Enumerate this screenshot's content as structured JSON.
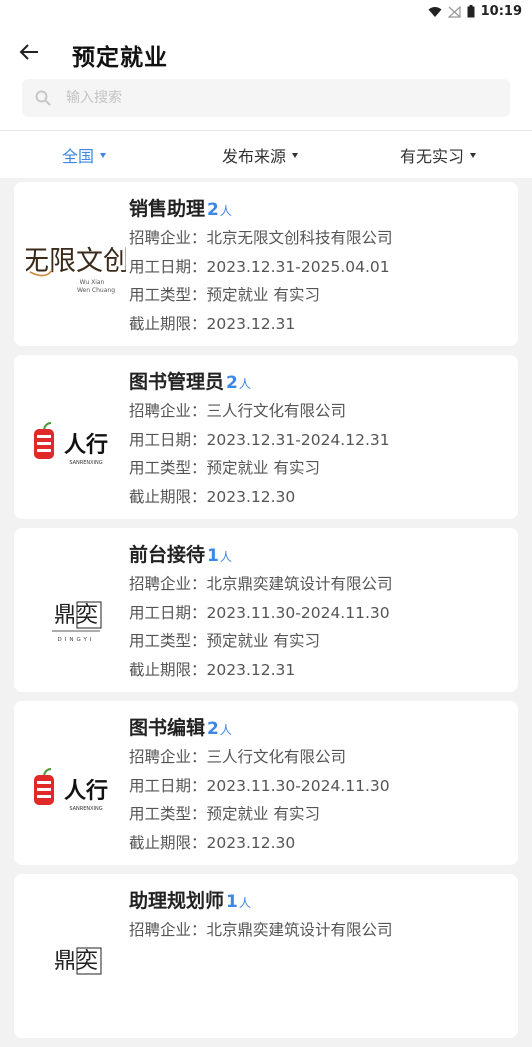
{
  "status_bar": {
    "time": "10:19"
  },
  "header": {
    "title": "预定就业"
  },
  "search": {
    "placeholder": "输入搜索"
  },
  "filters": [
    {
      "label": "全国",
      "active": true
    },
    {
      "label": "发布来源",
      "active": false
    },
    {
      "label": "有无实习",
      "active": false
    }
  ],
  "field_labels": {
    "company": "招聘企业：",
    "dates": "用工日期：",
    "type": "用工类型：",
    "deadline": "截止期限："
  },
  "count_unit": "人",
  "logos": {
    "wuxian": {
      "main": "无限文创",
      "sub1": "Wu Xian",
      "sub2": "Wen Chuang"
    },
    "sanrenxing": {
      "main": "人行",
      "sub": "SANRENXING"
    },
    "dingyi": {
      "main": "鼎奕",
      "sub": "DINGYI"
    }
  },
  "jobs": [
    {
      "title": "销售助理",
      "count": "2",
      "company": "北京无限文创科技有限公司",
      "dates": "2023.12.31-2025.04.01",
      "type": "预定就业 有实习",
      "deadline": "2023.12.31",
      "logo": "wuxian"
    },
    {
      "title": "图书管理员",
      "count": "2",
      "company": "三人行文化有限公司",
      "dates": "2023.12.31-2024.12.31",
      "type": "预定就业 有实习",
      "deadline": "2023.12.30",
      "logo": "sanrenxing"
    },
    {
      "title": "前台接待",
      "count": "1",
      "company": "北京鼎奕建筑设计有限公司",
      "dates": "2023.11.30-2024.11.30",
      "type": "预定就业 有实习",
      "deadline": "2023.12.31",
      "logo": "dingyi"
    },
    {
      "title": "图书编辑",
      "count": "2",
      "company": "三人行文化有限公司",
      "dates": "2023.11.30-2024.11.30",
      "type": "预定就业 有实习",
      "deadline": "2023.12.30",
      "logo": "sanrenxing"
    },
    {
      "title": "助理规划师",
      "count": "1",
      "company": "北京鼎奕建筑设计有限公司",
      "dates": "",
      "type": "",
      "deadline": "",
      "logo": "dingyi"
    }
  ]
}
